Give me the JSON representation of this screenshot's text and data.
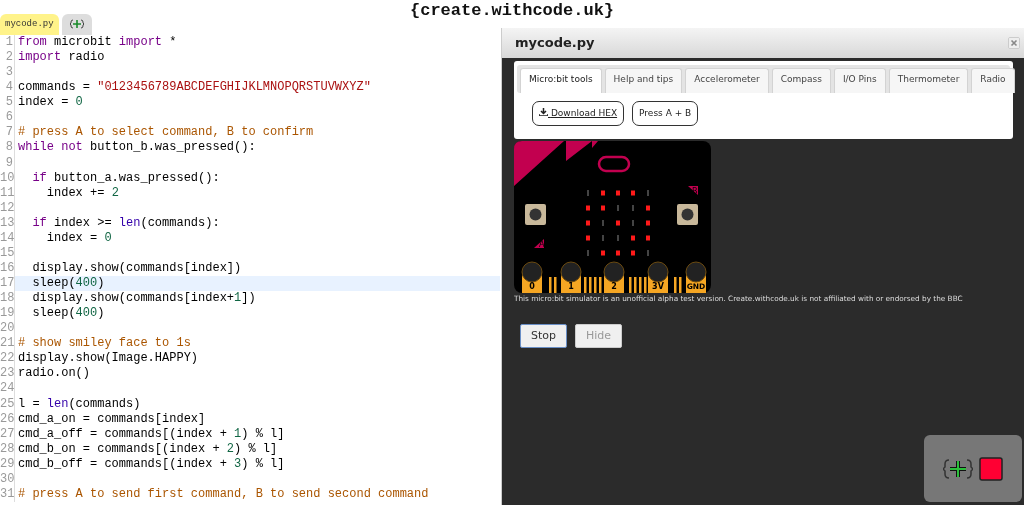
{
  "site_title": "{create.withcode.uk}",
  "editor": {
    "tabs": [
      {
        "label": "mycode.py",
        "kind": "text",
        "selected": true
      },
      {
        "kind": "icon",
        "selected": false
      }
    ],
    "lines": [
      {
        "number": "1",
        "highlighted": false,
        "tokens": [
          {
            "kind": "kw",
            "text": "from"
          },
          {
            "kind": "p",
            "text": " microbit "
          },
          {
            "kind": "kw",
            "text": "import"
          },
          {
            "kind": "p",
            "text": " *"
          }
        ]
      },
      {
        "number": "2",
        "highlighted": false,
        "tokens": [
          {
            "kind": "kw",
            "text": "import"
          },
          {
            "kind": "p",
            "text": " radio"
          }
        ]
      },
      {
        "number": "3",
        "highlighted": false
      },
      {
        "number": "4",
        "highlighted": false,
        "tokens": [
          {
            "kind": "p",
            "text": "commands = "
          },
          {
            "kind": "str",
            "text": "\"0123456789ABCDEFGHIJKLMNOPQRSTUVWXYZ\""
          }
        ]
      },
      {
        "number": "5",
        "highlighted": false,
        "tokens": [
          {
            "kind": "p",
            "text": "index = "
          },
          {
            "kind": "num",
            "text": "0"
          }
        ]
      },
      {
        "number": "6",
        "highlighted": false
      },
      {
        "number": "7",
        "highlighted": false,
        "tokens": [
          {
            "kind": "com",
            "text": "# press A to select command, B to confirm"
          }
        ]
      },
      {
        "number": "8",
        "highlighted": false,
        "tokens": [
          {
            "kind": "kw",
            "text": "while"
          },
          {
            "kind": "kw",
            "text": " not"
          },
          {
            "kind": "p",
            "text": " button_b.was_pressed():"
          }
        ]
      },
      {
        "number": "9",
        "highlighted": false
      },
      {
        "number": "10",
        "highlighted": false,
        "tokens": [
          {
            "kind": "kw",
            "text": "  if"
          },
          {
            "kind": "p",
            "text": " button_a.was_pressed():"
          }
        ]
      },
      {
        "number": "11",
        "highlighted": false,
        "tokens": [
          {
            "kind": "p",
            "text": "    index += "
          },
          {
            "kind": "num",
            "text": "2"
          }
        ]
      },
      {
        "number": "12",
        "highlighted": false
      },
      {
        "number": "13",
        "highlighted": false,
        "tokens": [
          {
            "kind": "kw",
            "text": "  if"
          },
          {
            "kind": "p",
            "text": " index >= "
          },
          {
            "kind": "bi",
            "text": "len"
          },
          {
            "kind": "p",
            "text": "(commands):"
          }
        ]
      },
      {
        "number": "14",
        "highlighted": false,
        "tokens": [
          {
            "kind": "p",
            "text": "    index = "
          },
          {
            "kind": "num",
            "text": "0"
          }
        ]
      },
      {
        "number": "15",
        "highlighted": false
      },
      {
        "number": "16",
        "highlighted": false,
        "tokens": [
          {
            "kind": "p",
            "text": "  display.show(commands[index])"
          }
        ]
      },
      {
        "number": "17",
        "highlighted": true,
        "tokens": [
          {
            "kind": "p",
            "text": "  sleep("
          },
          {
            "kind": "num",
            "text": "400"
          },
          {
            "kind": "p",
            "text": ")"
          }
        ]
      },
      {
        "number": "18",
        "highlighted": false,
        "tokens": [
          {
            "kind": "p",
            "text": "  display.show(commands[index+"
          },
          {
            "kind": "num",
            "text": "1"
          },
          {
            "kind": "p",
            "text": "])"
          }
        ]
      },
      {
        "number": "19",
        "highlighted": false,
        "tokens": [
          {
            "kind": "p",
            "text": "  sleep("
          },
          {
            "kind": "num",
            "text": "400"
          },
          {
            "kind": "p",
            "text": ")"
          }
        ]
      },
      {
        "number": "20",
        "highlighted": false
      },
      {
        "number": "21",
        "highlighted": false,
        "tokens": [
          {
            "kind": "com",
            "text": "# show smiley face to 1s"
          }
        ]
      },
      {
        "number": "22",
        "highlighted": false,
        "tokens": [
          {
            "kind": "p",
            "text": "display.show(Image.HAPPY)"
          }
        ]
      },
      {
        "number": "23",
        "highlighted": false,
        "tokens": [
          {
            "kind": "p",
            "text": "radio.on()"
          }
        ]
      },
      {
        "number": "24",
        "highlighted": false
      },
      {
        "number": "25",
        "highlighted": false,
        "tokens": [
          {
            "kind": "p",
            "text": "l = "
          },
          {
            "kind": "bi",
            "text": "len"
          },
          {
            "kind": "p",
            "text": "(commands)"
          }
        ]
      },
      {
        "number": "26",
        "highlighted": false,
        "tokens": [
          {
            "kind": "p",
            "text": "cmd_a_on = commands[index]"
          }
        ]
      },
      {
        "number": "27",
        "highlighted": false,
        "tokens": [
          {
            "kind": "p",
            "text": "cmd_a_off = commands[(index + "
          },
          {
            "kind": "num",
            "text": "1"
          },
          {
            "kind": "p",
            "text": ") % l]"
          }
        ]
      },
      {
        "number": "28",
        "highlighted": false,
        "tokens": [
          {
            "kind": "p",
            "text": "cmd_b_on = commands[(index + "
          },
          {
            "kind": "num",
            "text": "2"
          },
          {
            "kind": "p",
            "text": ") % l]"
          }
        ]
      },
      {
        "number": "29",
        "highlighted": false,
        "tokens": [
          {
            "kind": "p",
            "text": "cmd_b_off = commands[(index + "
          },
          {
            "kind": "num",
            "text": "3"
          },
          {
            "kind": "p",
            "text": ") % l]"
          }
        ]
      },
      {
        "number": "30",
        "highlighted": false
      },
      {
        "number": "31",
        "highlighted": false,
        "tokens": [
          {
            "kind": "com",
            "text": "# press A to send first command, B to send second command"
          }
        ]
      }
    ]
  },
  "window": {
    "title": "mycode.py",
    "tabs": [
      {
        "label": "Micro:bit tools",
        "selected": true
      },
      {
        "label": "Help and tips",
        "selected": false
      },
      {
        "label": "Accelerometer",
        "selected": false
      },
      {
        "label": "Compass",
        "selected": false
      },
      {
        "label": "I/O Pins",
        "selected": false
      },
      {
        "label": "Thermometer",
        "selected": false
      },
      {
        "label": "Radio",
        "selected": false
      }
    ],
    "tool_buttons": [
      {
        "label": "Download HEX",
        "kind": "download"
      },
      {
        "label": "Press A + B",
        "kind": "plain"
      }
    ],
    "simulator": {
      "leds": [
        [
          false,
          true,
          true,
          true,
          false
        ],
        [
          true,
          true,
          false,
          false,
          true
        ],
        [
          true,
          false,
          true,
          false,
          true
        ],
        [
          true,
          false,
          false,
          true,
          true
        ],
        [
          false,
          true,
          true,
          true,
          false
        ]
      ],
      "button_labels": [
        "A",
        "B"
      ],
      "pins": [
        "0",
        "1",
        "2",
        "3V",
        "GND"
      ]
    },
    "disclaimer": "This micro:bit simulator is an unofficial alpha test version. Create.withcode.uk is not affiliated with or endorsed by the BBC",
    "buttons": [
      {
        "label": "Stop",
        "selected": true
      },
      {
        "label": "Hide",
        "selected": false
      }
    ]
  }
}
